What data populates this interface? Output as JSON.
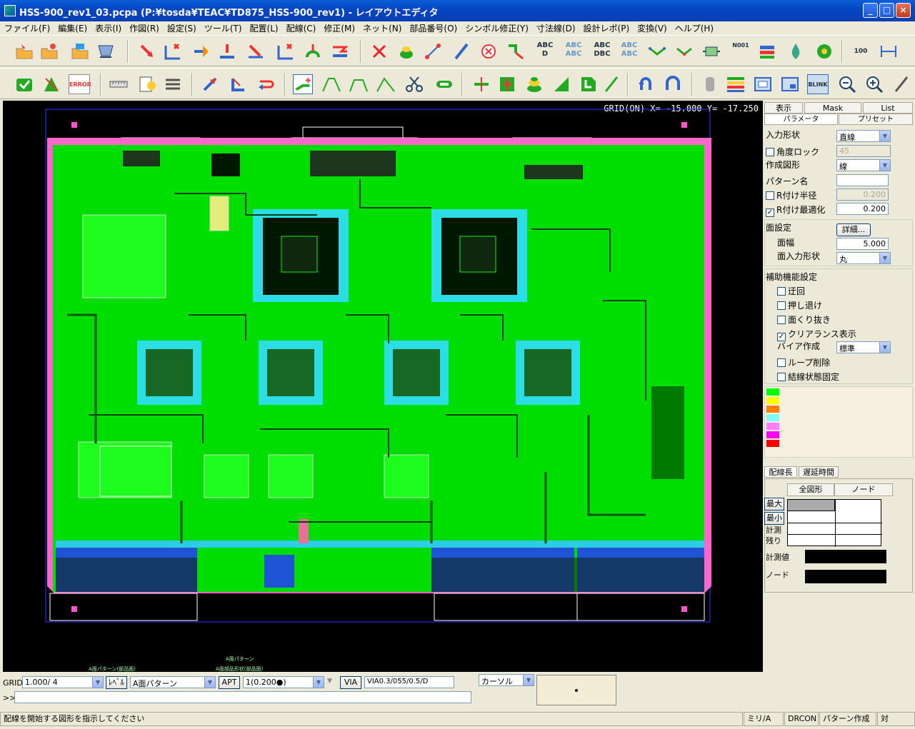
{
  "window": {
    "title": "HSS-900_rev1_03.pcpa (P:¥tosda¥TEAC¥TD875_HSS-900_rev1) - レイアウトエディタ",
    "controls": [
      "_",
      "□",
      "×"
    ]
  },
  "menu": [
    "ファイル(F)",
    "編集(E)",
    "表示(I)",
    "作図(R)",
    "設定(S)",
    "ツール(T)",
    "配置(L)",
    "配線(C)",
    "修正(M)",
    "ネット(N)",
    "部品番号(O)",
    "シンボル修正(Y)",
    "寸法線(D)",
    "設計レポ(P)",
    "変換(V)",
    "ヘルプ(H)"
  ],
  "toolbar1": {
    "text_icons": [
      "ABC D",
      "ABC ABC",
      "ABC DBC",
      "ABC ABC",
      "N001",
      "100"
    ]
  },
  "toolbar2": {
    "text_icons": [
      "ERROR",
      "BLINK"
    ]
  },
  "canvas": {
    "grid_readout": "GRID(ON) X= -15.000 Y= -17.250",
    "bottom_labels": [
      "A面パターン",
      "A面パターン(部品面)",
      "A面部品形状(部品面)"
    ]
  },
  "panel": {
    "top_tabs": [
      "表示",
      "Mask",
      "List"
    ],
    "sub_tabs": [
      "パラメータ",
      "プリセット"
    ],
    "input_shape_label": "入力形状",
    "input_shape_value": "直線",
    "angle_lock_label": "角度ロック",
    "angle_lock_value": "45",
    "create_figure_label": "作成図形",
    "create_figure_value": "線",
    "pattern_name_label": "パターン名",
    "pattern_name_value": "",
    "r_radius_label": "R付け半径",
    "r_radius_value": "0.200",
    "r_opt_label": "R付け最適化",
    "r_opt_value": "0.200",
    "area_settings_label": "面設定",
    "detail_button": "詳細...",
    "area_width_label": "面幅",
    "area_width_value": "5.000",
    "area_shape_label": "面入力形状",
    "area_shape_value": "丸",
    "assist_label": "補助機能設定",
    "assist_items": [
      {
        "label": "迂回",
        "checked": false
      },
      {
        "label": "押し退け",
        "checked": false
      },
      {
        "label": "面くり抜き",
        "checked": false
      },
      {
        "label": "クリアランス表示",
        "checked": true
      }
    ],
    "via_label": "バイア作成",
    "via_value": "標準",
    "assist_items2": [
      {
        "label": "ループ削除",
        "checked": false
      },
      {
        "label": "結線状態固定",
        "checked": false
      }
    ],
    "swatches": [
      "#00ff00",
      "#ffff00",
      "#ff8000",
      "#80ffff",
      "#ff80ff",
      "#ff00ff",
      "#ff0000"
    ],
    "length_tabs": [
      "配線長",
      "遅延時間"
    ],
    "length_table_headers": [
      "全図形",
      "ノード"
    ],
    "length_rows": [
      "最大",
      "最小",
      "計測",
      "残り"
    ],
    "measured_label": "計測値",
    "node_label": "ノード"
  },
  "bottom": {
    "grid_label": "GRID",
    "grid_value": "1.000/ 4",
    "level_button": "ﾚﾍﾞﾙ",
    "level_value": "A面パターン",
    "apt_button": "APT",
    "apt_value": "1(0.200●)",
    "via_button": "VIA",
    "via_value": "VIA0.3/055/0.5/D",
    "cursor_value": "カーソル",
    "prompt": ">>",
    "status_message": "配線を開始する図形を指示してください",
    "status_unit": "ミリ/A",
    "status_drcon": "DRCON",
    "status_mode": "パターン作成",
    "status_last": "対"
  }
}
